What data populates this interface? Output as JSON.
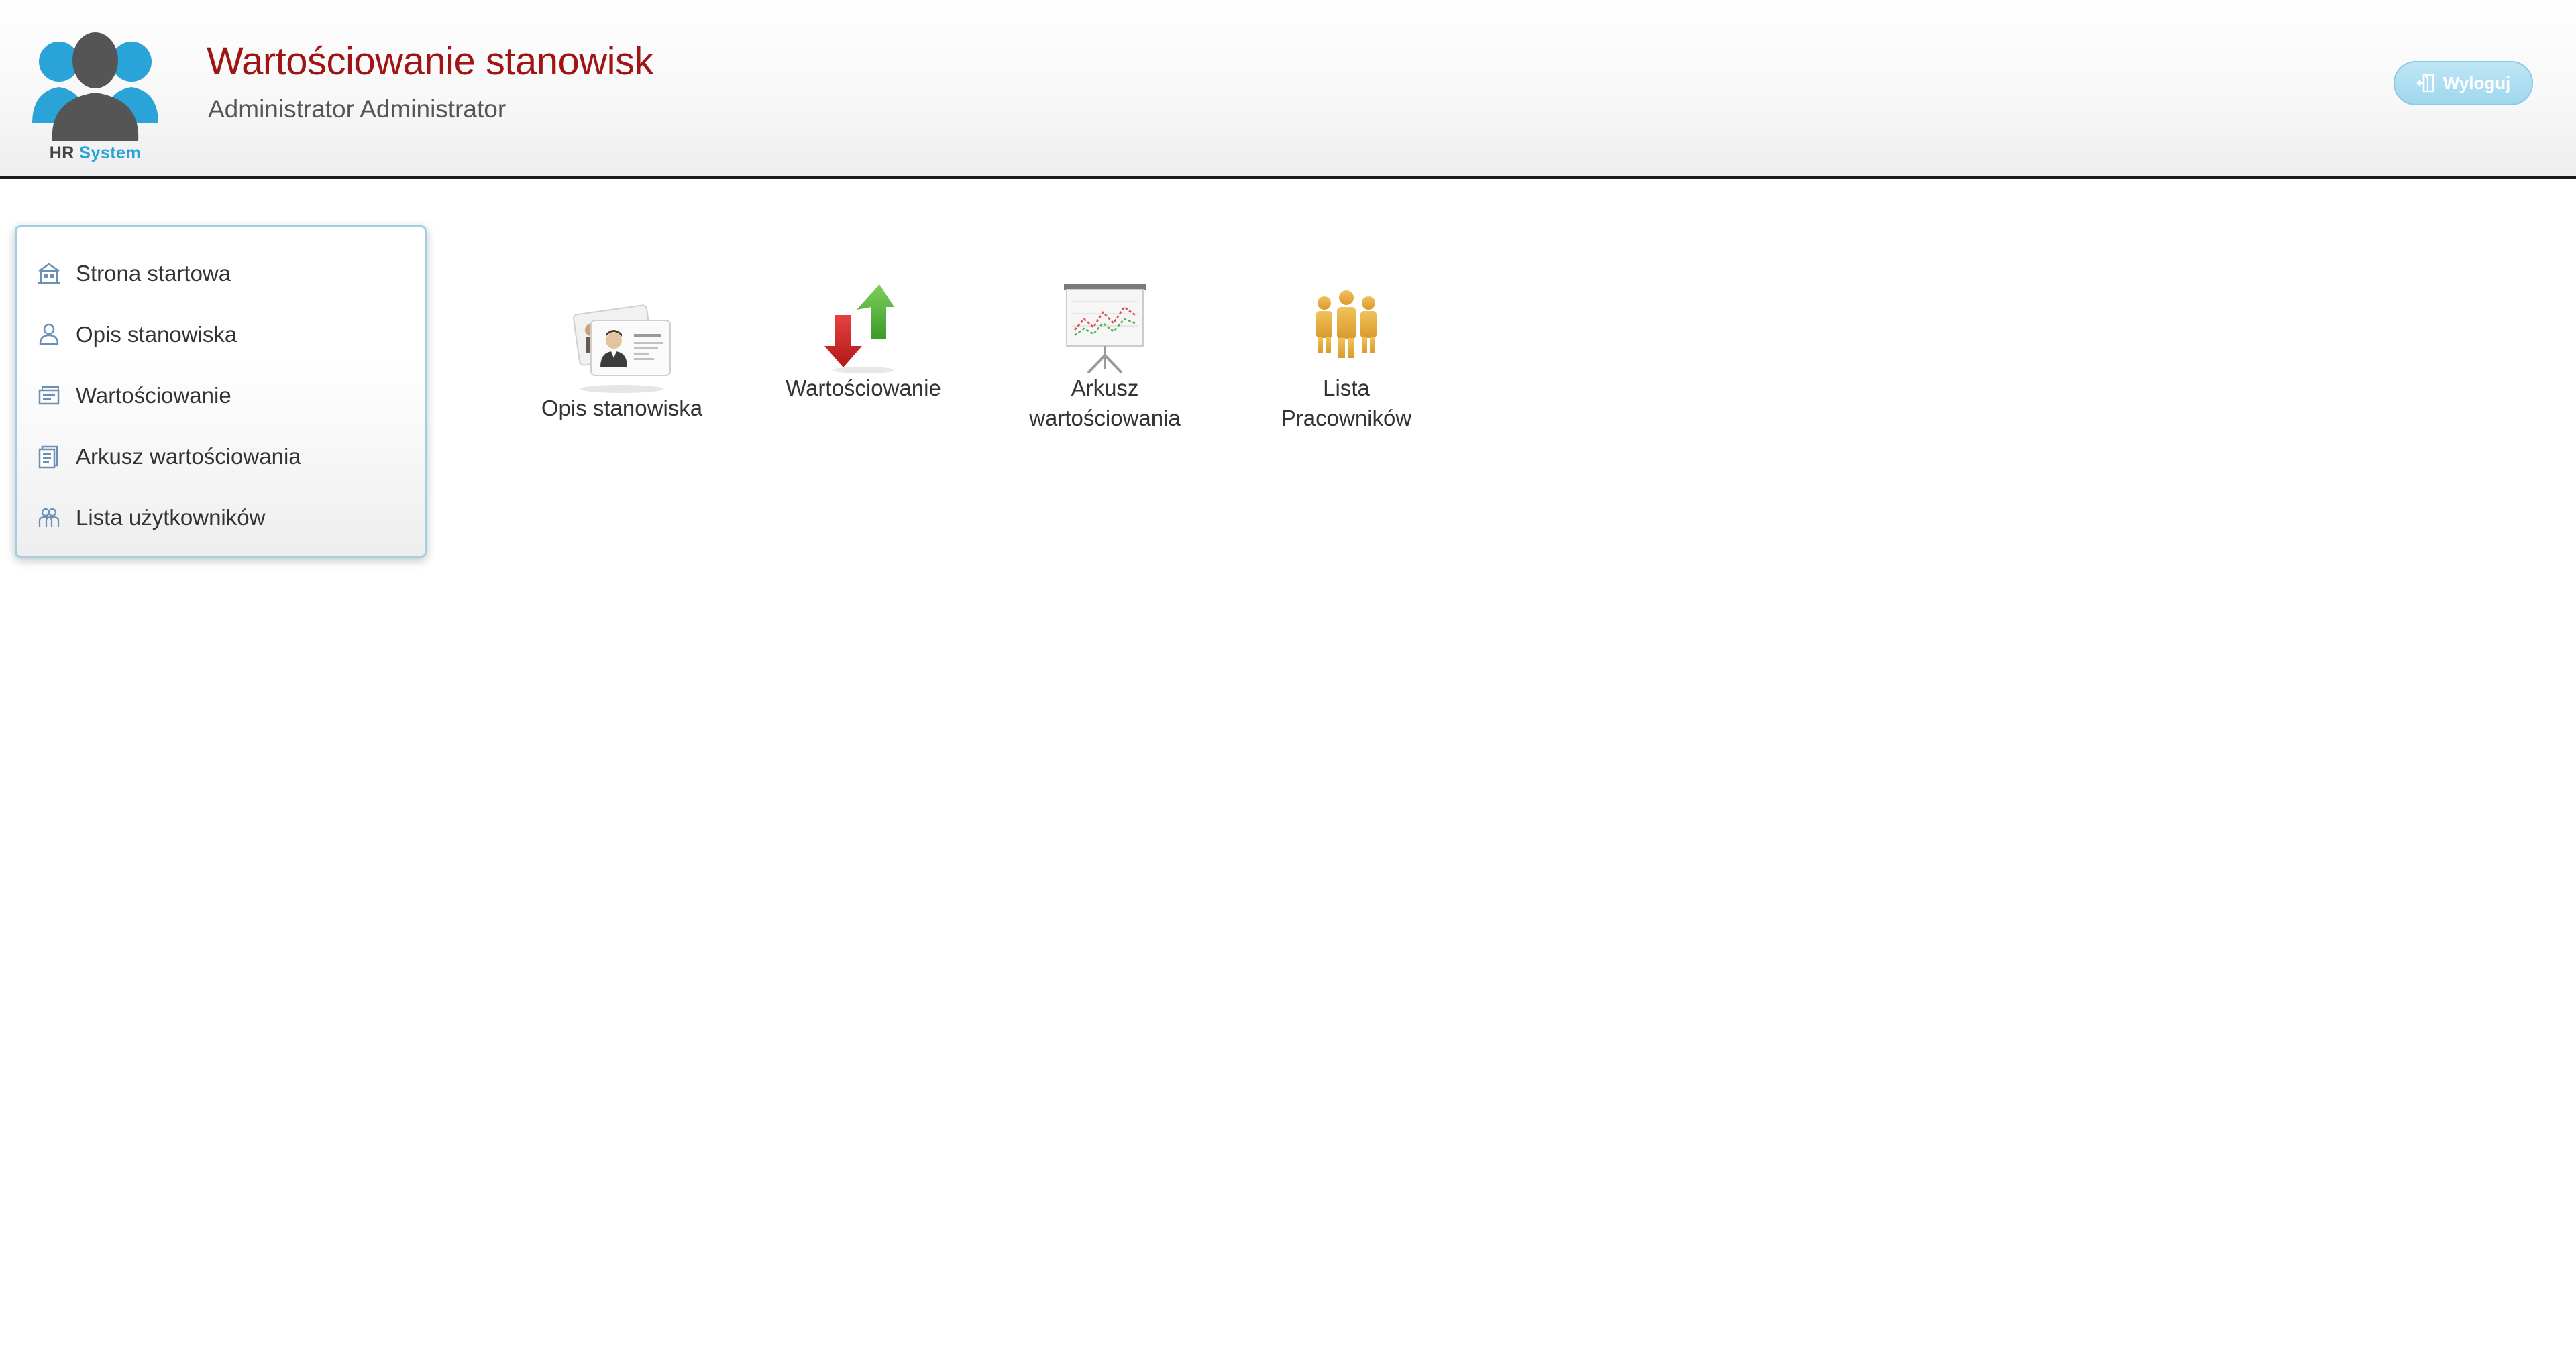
{
  "header": {
    "logo": {
      "text_hr": "HR",
      "text_system": "System"
    },
    "title": "Wartościowanie stanowisk",
    "user": "Administrator Administrator",
    "logout_label": "Wyloguj"
  },
  "sidebar": {
    "items": [
      {
        "label": "Strona startowa",
        "icon": "home-icon"
      },
      {
        "label": "Opis stanowiska",
        "icon": "person-icon"
      },
      {
        "label": "Wartościowanie",
        "icon": "valuation-icon"
      },
      {
        "label": "Arkusz wartościowania",
        "icon": "sheet-icon"
      },
      {
        "label": "Lista użytkowników",
        "icon": "users-icon"
      }
    ]
  },
  "tiles": [
    {
      "label": "Opis stanowiska",
      "icon": "id-card-icon"
    },
    {
      "label": "Wartościowanie",
      "icon": "up-down-arrows-icon"
    },
    {
      "label_line1": "Arkusz",
      "label_line2": "wartościowania",
      "icon": "presentation-board-icon"
    },
    {
      "label_line1": "Lista",
      "label_line2": "Pracowników",
      "icon": "employees-icon"
    }
  ],
  "colors": {
    "title": "#a11414",
    "accent": "#29a3d8",
    "logout_bg": "#9fd7ee",
    "header_border": "#1a1a1a"
  }
}
